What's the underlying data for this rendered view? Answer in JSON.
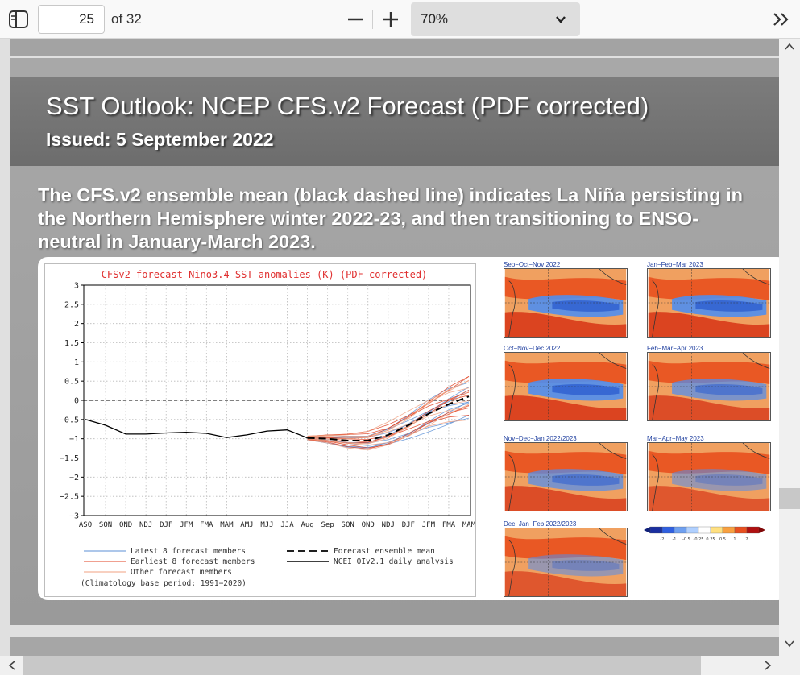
{
  "toolbar": {
    "page_number": "25",
    "page_total_label": "of 32",
    "zoom_value": "70%",
    "icons": [
      "sidebar-toggle-icon",
      "zoom-out-icon",
      "zoom-in-icon",
      "chevron-down-icon",
      "more-tools-icon"
    ]
  },
  "slide": {
    "title": "SST Outlook: NCEP CFS.v2 Forecast (PDF corrected)",
    "issued": "Issued: 5 September 2022",
    "body_line1": "The CFS.v2 ensemble mean (black dashed line) indicates La Niña persisting in",
    "body_line2": "the Northern Hemisphere winter 2022-23, and then transitioning to ENSO-",
    "body_line3": "neutral in January-March 2023."
  },
  "chart_data": {
    "type": "line",
    "title": "CFSv2 forecast Nino3.4 SST anomalies (K) (PDF corrected)",
    "xlabel": "",
    "ylabel": "",
    "categories": [
      "ASO",
      "SON",
      "OND",
      "NDJ",
      "DJF",
      "JFM",
      "FMA",
      "MAM",
      "AMJ",
      "MJJ",
      "JJA",
      "Aug",
      "Sep",
      "SON",
      "OND",
      "NDJ",
      "DJF",
      "JFM",
      "FMA",
      "MAM"
    ],
    "yticks": [
      "3",
      "2.5",
      "2",
      "1.5",
      "1",
      "0.5",
      "0",
      "−0.5",
      "−1",
      "−1.5",
      "−2",
      "−2.5",
      "−3"
    ],
    "ylim": [
      -3,
      3
    ],
    "grid": true,
    "series": [
      {
        "name": "NCEI OIv2.1 daily analysis",
        "values": [
          -0.5,
          -0.65,
          -0.88,
          -0.88,
          -0.85,
          -0.83,
          -0.86,
          -0.97,
          -0.9,
          -0.8,
          -0.77,
          -0.98,
          null,
          null,
          null,
          null,
          null,
          null,
          null,
          null
        ]
      },
      {
        "name": "Forecast ensemble mean",
        "values": [
          null,
          null,
          null,
          null,
          null,
          null,
          null,
          null,
          null,
          null,
          null,
          -0.98,
          -1.0,
          -1.05,
          -1.05,
          -0.9,
          -0.65,
          -0.35,
          -0.1,
          0.1
        ]
      }
    ],
    "legend": {
      "latest": "Latest 8 forecast members",
      "earliest": "Earliest 8 forecast members",
      "other": "Other forecast members",
      "mean": "Forecast ensemble mean",
      "analysis": "NCEI OIv2.1 daily analysis",
      "note": "(Climatology base period: 1991−2020)"
    },
    "colors": {
      "latest": "#5b8fd6",
      "earliest": "#e04020",
      "other": "#f0a080",
      "mean": "#000000",
      "title": "#e03030"
    }
  },
  "maps": {
    "titles": [
      "Sep−Oct−Nov 2022",
      "Jan−Feb−Mar 2023",
      "Oct−Nov−Dec 2022",
      "Feb−Mar−Apr 2023",
      "Nov−Dec−Jan 2022/2023",
      "Mar−Apr−May 2023",
      "Dec−Jan−Feb 2022/2023"
    ],
    "colorbar_labels": [
      "-2",
      "-1",
      "-0.5",
      "-0.25",
      "0.25",
      "0.5",
      "1",
      "2"
    ]
  }
}
